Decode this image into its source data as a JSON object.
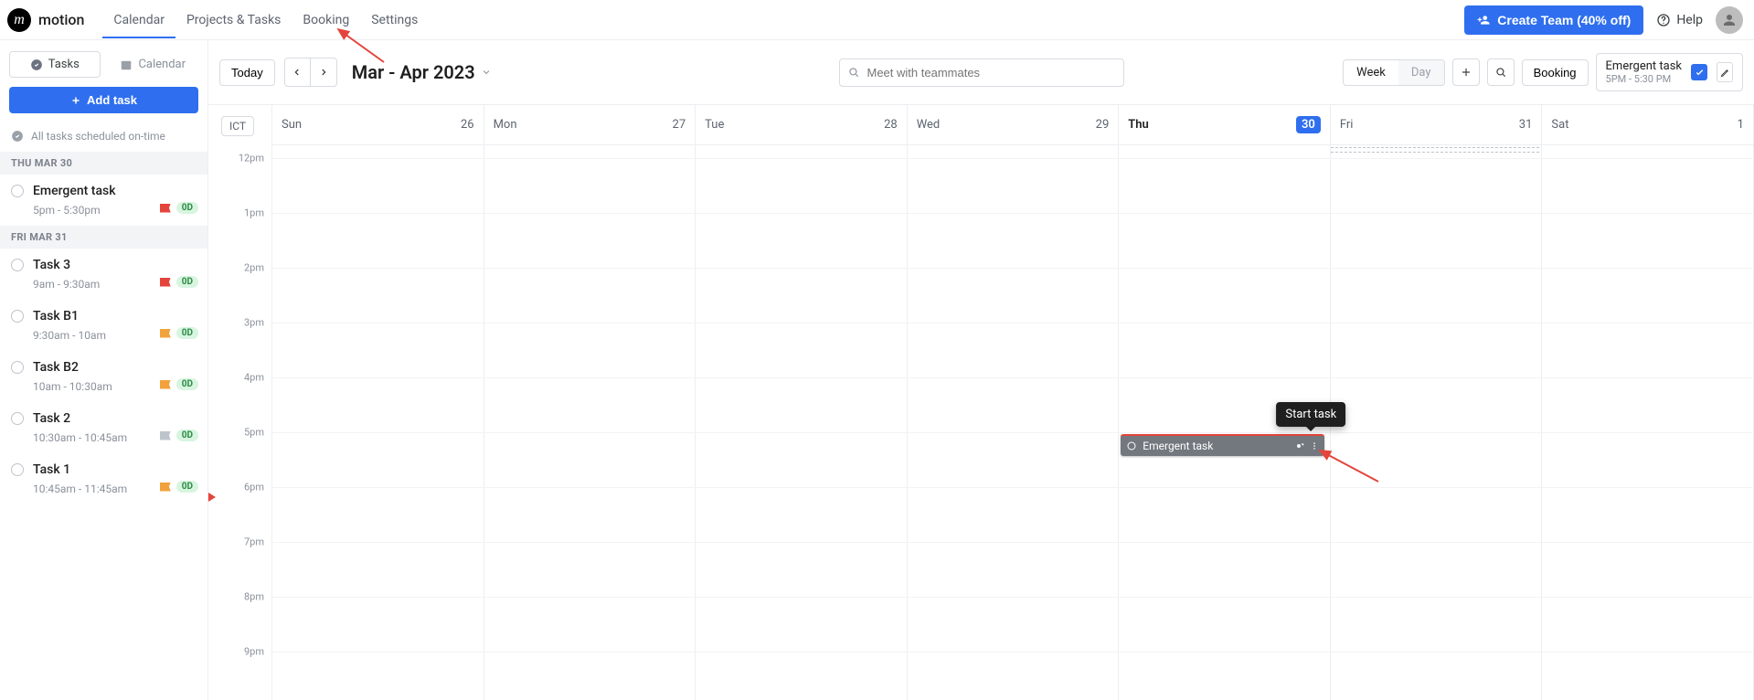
{
  "brand": "motion",
  "nav": {
    "items": [
      "Calendar",
      "Projects & Tasks",
      "Booking",
      "Settings"
    ],
    "active_index": 0
  },
  "topright": {
    "create_team": "Create Team (40% off)",
    "help": "Help"
  },
  "sidebar": {
    "toggle": {
      "tasks": "Tasks",
      "calendar": "Calendar",
      "active": "tasks"
    },
    "add_task": "Add task",
    "status_text": "All tasks scheduled on-time",
    "groups": [
      {
        "label": "THU MAR 30",
        "tasks": [
          {
            "title": "Emergent task",
            "time": "5pm - 5:30pm",
            "flag": "red",
            "badge": "0D"
          }
        ]
      },
      {
        "label": "FRI MAR 31",
        "tasks": [
          {
            "title": "Task 3",
            "time": "9am - 9:30am",
            "flag": "red",
            "badge": "0D"
          },
          {
            "title": "Task B1",
            "time": "9:30am - 10am",
            "flag": "orange",
            "badge": "0D"
          },
          {
            "title": "Task B2",
            "time": "10am - 10:30am",
            "flag": "orange",
            "badge": "0D"
          },
          {
            "title": "Task 2",
            "time": "10:30am - 10:45am",
            "flag": "grey",
            "badge": "0D"
          },
          {
            "title": "Task 1",
            "time": "10:45am - 11:45am",
            "flag": "orange",
            "badge": "0D"
          }
        ]
      }
    ]
  },
  "toolbar": {
    "today": "Today",
    "range": "Mar - Apr 2023",
    "search_placeholder": "Meet with teammates",
    "views": {
      "week": "Week",
      "day": "Day",
      "active": "week"
    },
    "booking": "Booking",
    "card": {
      "title": "Emergent task",
      "subtitle": "5PM - 5:30 PM"
    }
  },
  "calendar": {
    "timezone": "ICT",
    "days": [
      {
        "dow": "Sun",
        "num": "26"
      },
      {
        "dow": "Mon",
        "num": "27"
      },
      {
        "dow": "Tue",
        "num": "28"
      },
      {
        "dow": "Wed",
        "num": "29"
      },
      {
        "dow": "Thu",
        "num": "30",
        "today": true
      },
      {
        "dow": "Fri",
        "num": "31"
      },
      {
        "dow": "Sat",
        "num": "1"
      }
    ],
    "hours": [
      "12pm",
      "1pm",
      "2pm",
      "3pm",
      "4pm",
      "5pm",
      "6pm",
      "7pm",
      "8pm",
      "9pm"
    ],
    "event": {
      "day_index": 4,
      "start_hour_index": 5,
      "duration_slots": 0.5,
      "title": "Emergent task",
      "tooltip": "Start task"
    }
  }
}
